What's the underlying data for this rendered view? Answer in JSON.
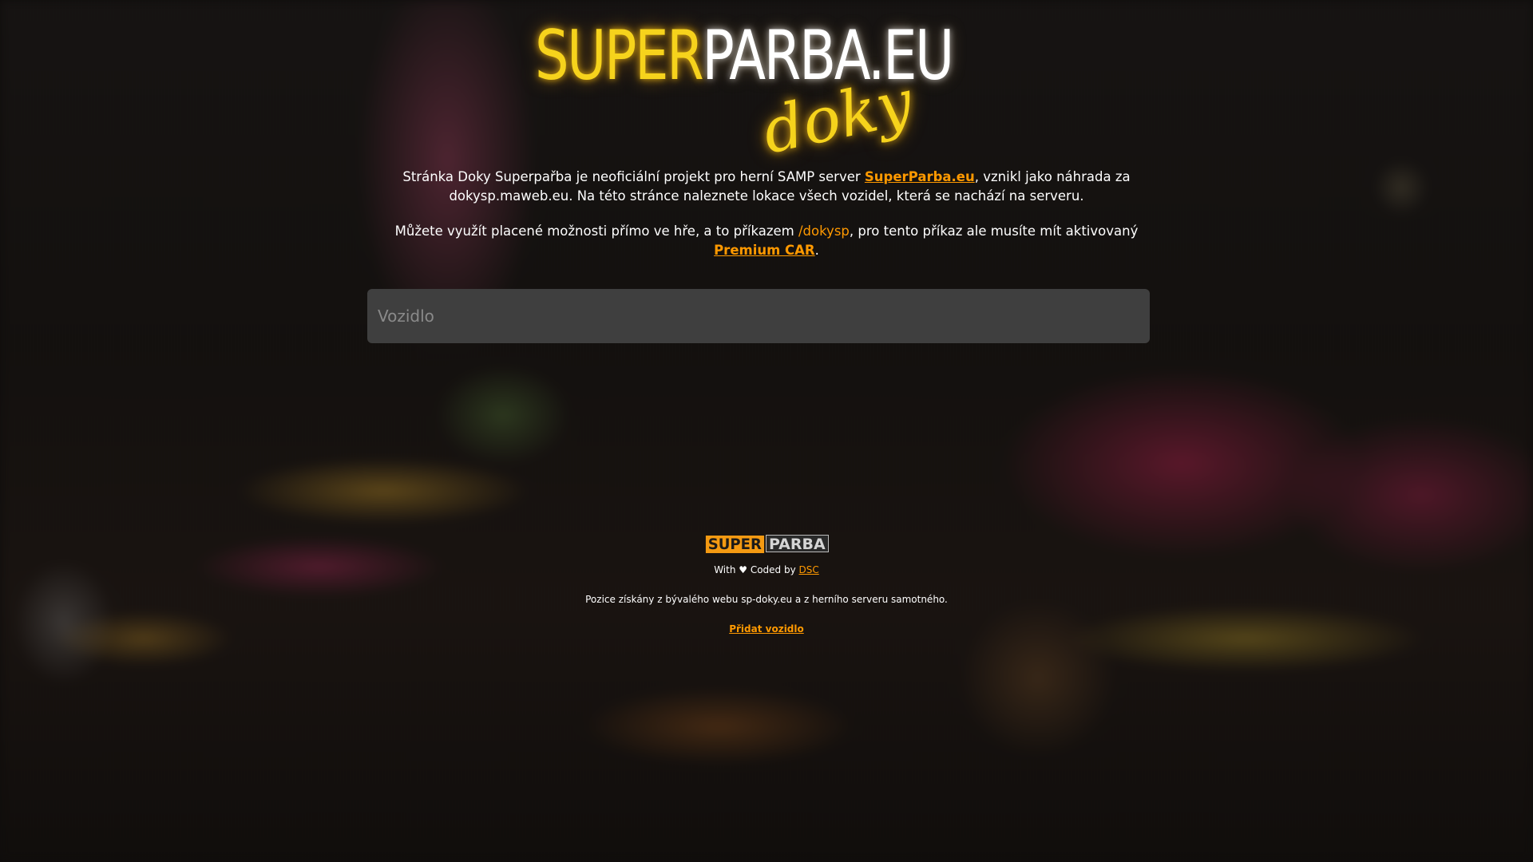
{
  "logo": {
    "super": "SUPER",
    "parba": "PARBA.EU",
    "doky": "doky"
  },
  "intro": {
    "p1_before": "Stránka Doky Superpařba je neoficiální projekt pro herní SAMP server ",
    "p1_link": "SuperParba.eu",
    "p1_after": ", vznikl jako náhrada za dokysp.maweb.eu. Na této stránce naleznete lokace všech vozidel, která se nachází na serveru.",
    "p2_before": "Můžete využít placené možnosti přímo ve hře, a to příkazem ",
    "p2_command": "/dokysp",
    "p2_middle": ", pro tento příkaz ale musíte mít aktivovaný ",
    "p2_link": "Premium CAR",
    "p2_after": "."
  },
  "search": {
    "placeholder": "Vozidlo",
    "value": ""
  },
  "footer": {
    "logo_super": "SUPER",
    "logo_parba": "PARBA",
    "credit_before": "With ♥ Coded by ",
    "credit_link": "DSC",
    "source_text": "Pozice získány z bývalého webu sp-doky.eu a z herního serveru samotného.",
    "add_vehicle_link": "Přidat vozidlo"
  },
  "colors": {
    "accent": "#ff9900",
    "logo_yellow": "#f6d31c",
    "input_bg": "#3f3f3f"
  }
}
